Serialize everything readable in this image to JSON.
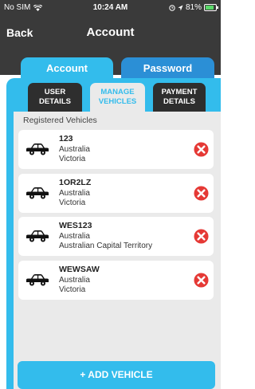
{
  "status_bar": {
    "carrier": "No SIM",
    "time": "10:24 AM",
    "battery": "81%",
    "battery_level": 0.81,
    "icons": [
      "wifi-icon",
      "alarm-icon",
      "location-icon",
      "battery-icon"
    ]
  },
  "nav": {
    "back_label": "Back",
    "title": "Account"
  },
  "top_tabs": [
    {
      "label": "Account",
      "active": true
    },
    {
      "label": "Password",
      "active": false
    }
  ],
  "sub_tabs": [
    {
      "line1": "USER",
      "line2": "DETAILS",
      "active": false
    },
    {
      "line1": "MANAGE",
      "line2": "VEHICLES",
      "active": true
    },
    {
      "line1": "PAYMENT",
      "line2": "DETAILS",
      "active": false
    }
  ],
  "section_title": "Registered Vehicles",
  "vehicles": [
    {
      "plate": "123",
      "country": "Australia",
      "region": "Victoria"
    },
    {
      "plate": "1OR2LZ",
      "country": "Australia",
      "region": "Victoria"
    },
    {
      "plate": "WES123",
      "country": "Australia",
      "region": "Australian Capital Territory"
    },
    {
      "plate": "WEWSAW",
      "country": "Australia",
      "region": "Victoria"
    }
  ],
  "add_button_label": "+ ADD VEHICLE",
  "colors": {
    "header": "#3a3a3a",
    "accent": "#33bcec",
    "tab_inactive": "#2b8fd6",
    "delete": "#e53935"
  }
}
